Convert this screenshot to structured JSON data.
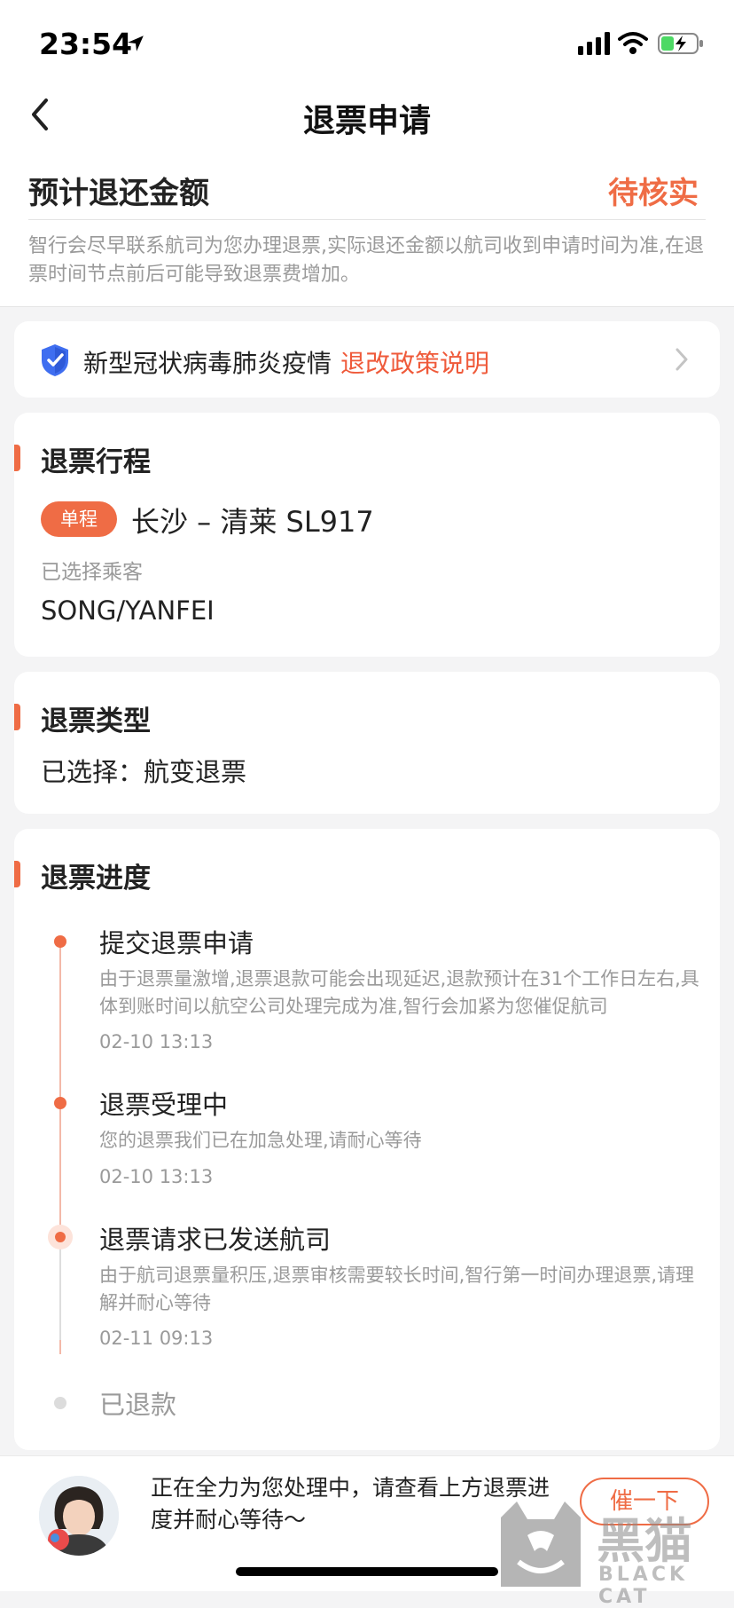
{
  "status_bar": {
    "time": "23:54"
  },
  "nav": {
    "title": "退票申请"
  },
  "estimate": {
    "label": "预计退还金额",
    "status": "待核实",
    "notice": "智行会尽早联系航司为您办理退票,实际退还金额以航司收到申请时间为准,在退票时间节点前后可能导致退票费增加。"
  },
  "covid": {
    "text": "新型冠状病毒肺炎疫情",
    "link": "退改政策说明"
  },
  "trip": {
    "title": "退票行程",
    "badge": "单程",
    "route": "长沙 – 清莱 SL917",
    "passenger_label": "已选择乘客",
    "passenger_name": "SONG/YANFEI"
  },
  "refund_type": {
    "title": "退票类型",
    "value": "已选择：航变退票"
  },
  "progress": {
    "title": "退票进度",
    "steps": [
      {
        "title": "提交退票申请",
        "desc": "由于退票量激增,退票退款可能会出现延迟,退款预计在31个工作日左右,具体到账时间以航空公司处理完成为准,智行会加紧为您催促航司",
        "time": "02-10 13:13"
      },
      {
        "title": "退票受理中",
        "desc": "您的退票我们已在加急处理,请耐心等待",
        "time": "02-10 13:13"
      },
      {
        "title": "退票请求已发送航司",
        "desc": "由于航司退票量积压,退票审核需要较长时间,智行第一时间办理退票,请理解并耐心等待",
        "time": "02-11 09:13"
      },
      {
        "title": "已退款"
      }
    ]
  },
  "bottom": {
    "message": "正在全力为您处理中，请查看上方退票进度并耐心等待～",
    "button": "催一下"
  },
  "watermark": {
    "text": "黑猫",
    "sub": "BLACK CAT"
  },
  "colors": {
    "accent": "#ef6c45",
    "link": "#ef5a3a",
    "muted": "#9a9a9a"
  }
}
